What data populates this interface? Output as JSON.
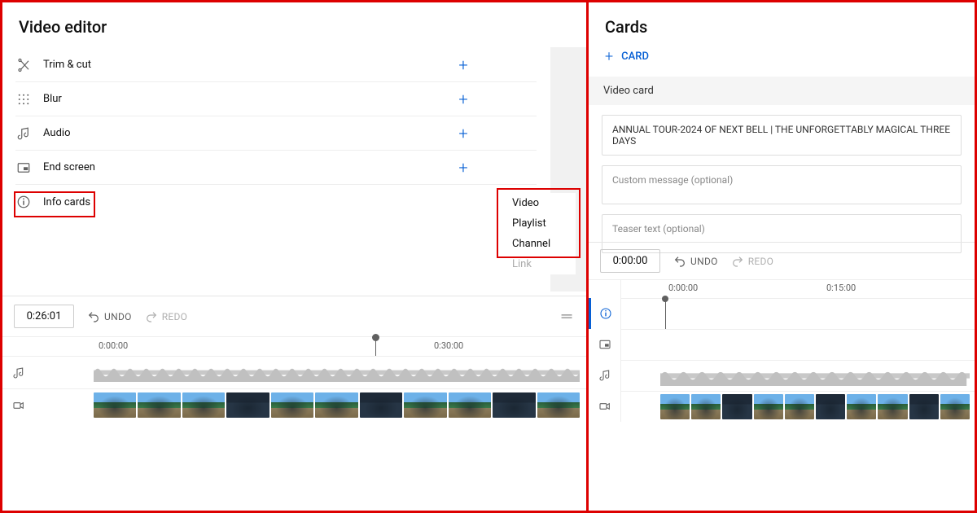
{
  "left": {
    "title": "Video editor",
    "rows": [
      {
        "icon": "scissors",
        "label": "Trim & cut"
      },
      {
        "icon": "blur-grid",
        "label": "Blur"
      },
      {
        "icon": "music-note",
        "label": "Audio"
      },
      {
        "icon": "endscreen",
        "label": "End screen"
      },
      {
        "icon": "info",
        "label": "Info cards"
      }
    ],
    "dropdown": [
      "Video",
      "Playlist",
      "Channel",
      "Link"
    ],
    "currentTime": "0:26:01",
    "undo": "UNDO",
    "redo": "REDO",
    "ticks": {
      "zero": "0:00:00",
      "thirty": "0:30:00"
    }
  },
  "right": {
    "title": "Cards",
    "addLabel": "CARD",
    "sectionTitle": "Video card",
    "videoTitle": "ANNUAL TOUR-2024 OF NEXT BELL | THE UNFORGETTABLY MAGICAL THREE DAYS",
    "customMsgPlaceholder": "Custom message (optional)",
    "teaserPlaceholder": "Teaser text (optional)",
    "currentTime": "0:00:00",
    "undo": "UNDO",
    "redo": "REDO",
    "ticks": {
      "zero": "0:00:00",
      "fifteen": "0:15:00"
    }
  }
}
